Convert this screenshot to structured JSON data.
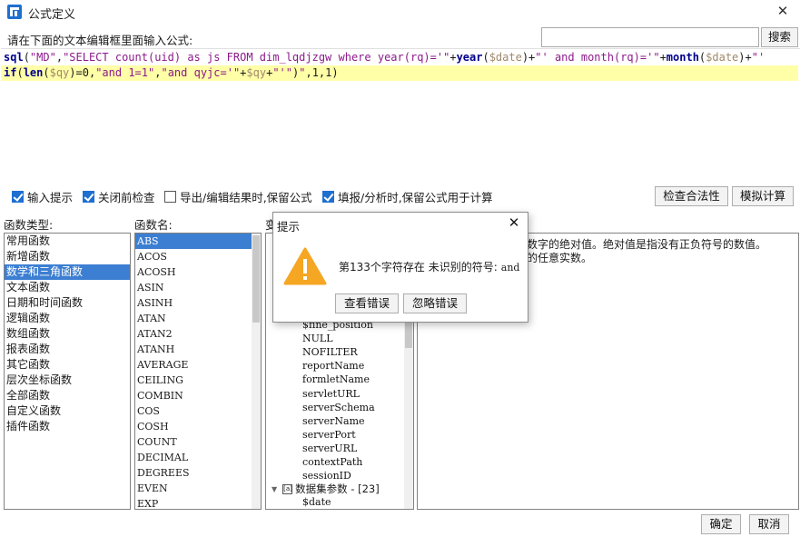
{
  "window": {
    "title": "公式定义"
  },
  "prompt_label": "请在下面的文本编辑框里面输入公式:",
  "search": {
    "value": "",
    "button_label": "搜索"
  },
  "editor": {
    "line1": [
      {
        "t": "sql",
        "c": "kw"
      },
      {
        "t": "(",
        "c": "plain"
      },
      {
        "t": "\"MD\"",
        "c": "str"
      },
      {
        "t": ",",
        "c": "plain"
      },
      {
        "t": "\"SELECT count(uid) as js FROM dim_lqdjzgw where year(rq)='\"",
        "c": "str"
      },
      {
        "t": "+",
        "c": "plain"
      },
      {
        "t": "year",
        "c": "kw"
      },
      {
        "t": "(",
        "c": "plain"
      },
      {
        "t": "$date",
        "c": "var"
      },
      {
        "t": ")+",
        "c": "plain"
      },
      {
        "t": "\"' and month(rq)='\"",
        "c": "str"
      },
      {
        "t": "+",
        "c": "plain"
      },
      {
        "t": "month",
        "c": "kw"
      },
      {
        "t": "(",
        "c": "plain"
      },
      {
        "t": "$date",
        "c": "var"
      },
      {
        "t": ")+",
        "c": "plain"
      },
      {
        "t": "\"'",
        "c": "str"
      }
    ],
    "line2": [
      {
        "t": "if",
        "c": "kw"
      },
      {
        "t": "(",
        "c": "plain"
      },
      {
        "t": "len",
        "c": "kw"
      },
      {
        "t": "(",
        "c": "plain"
      },
      {
        "t": "$qy",
        "c": "var"
      },
      {
        "t": ")=0,",
        "c": "plain"
      },
      {
        "t": "\"and 1=1\"",
        "c": "str"
      },
      {
        "t": ",",
        "c": "plain"
      },
      {
        "t": "\"and qyjc='\"",
        "c": "str"
      },
      {
        "t": "+",
        "c": "plain"
      },
      {
        "t": "$qy",
        "c": "var"
      },
      {
        "t": "+",
        "c": "plain"
      },
      {
        "t": "\"'\"",
        "c": "str"
      },
      {
        "t": ")",
        "c": "plain"
      },
      {
        "t": "\"",
        "c": "str"
      },
      {
        "t": ",1,1)",
        "c": "plain"
      }
    ]
  },
  "options": {
    "input_hint": {
      "label": "输入提示",
      "checked": true
    },
    "check_before_close": {
      "label": "关闭前检查",
      "checked": true
    },
    "keep_formula_export": {
      "label": "导出/编辑结果时,保留公式",
      "checked": false
    },
    "keep_formula_report": {
      "label": "填报/分析时,保留公式用于计算",
      "checked": true
    }
  },
  "buttons": {
    "check_validity": "检查合法性",
    "simulate": "模拟计算",
    "ok": "确定",
    "cancel": "取消"
  },
  "labels": {
    "func_type": "函数类型:",
    "func_name": "函数名:",
    "var_tree": "变"
  },
  "categories": [
    "常用函数",
    "新增函数",
    "数学和三角函数",
    "文本函数",
    "日期和时间函数",
    "逻辑函数",
    "数组函数",
    "报表函数",
    "其它函数",
    "层次坐标函数",
    "全部函数",
    "自定义函数",
    "插件函数"
  ],
  "selected_category": 2,
  "functions": [
    "ABS",
    "ACOS",
    "ACOSH",
    "ASIN",
    "ASINH",
    "ATAN",
    "ATAN2",
    "ATANH",
    "AVERAGE",
    "CEILING",
    "COMBIN",
    "COS",
    "COSH",
    "COUNT",
    "DECIMAL",
    "DEGREES",
    "EVEN",
    "EXP"
  ],
  "selected_function": 0,
  "tree_items": [
    "$fine_position",
    "NULL",
    "NOFILTER",
    "reportName",
    "formletName",
    "servletURL",
    "serverSchema",
    "serverName",
    "serverPort",
    "serverURL",
    "contextPath",
    "sessionID"
  ],
  "tree_group": "数据集参数 - [23]",
  "tree_group_child": "$date",
  "description": {
    "line1": "数字的绝对值。绝对值是指没有正负符号的数值。",
    "line2": "的任意实数。"
  },
  "modal": {
    "title": "提示",
    "message": "第133个字符存在 未识别的符号:",
    "symbol": "and",
    "view_error": "查看错误",
    "ignore_error": "忽略错误"
  },
  "colors": {
    "accent": "#3c7fd2",
    "keyword": "#00008b",
    "string": "#8b1a8b",
    "variable": "#a0896b",
    "highlight": "#ffffa8",
    "warning": "#f5a623"
  }
}
